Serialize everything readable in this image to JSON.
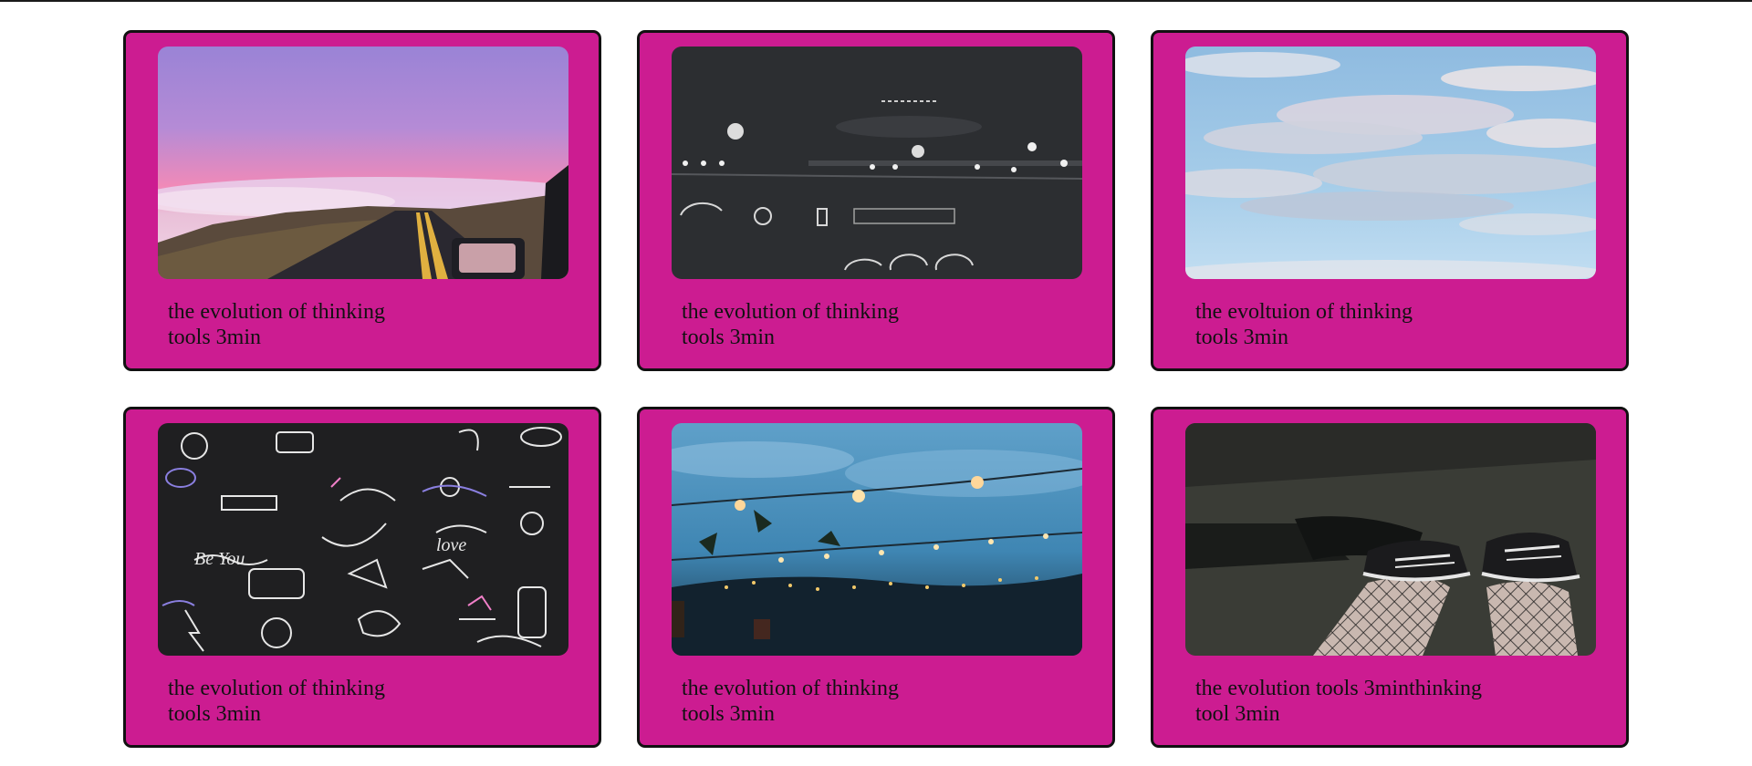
{
  "cards": [
    {
      "line1": "the evolution of thinking",
      "line2": "tools 3min",
      "image": "sunset-road-photo"
    },
    {
      "line1": "the evolution of thinking",
      "line2": "tools 3min",
      "image": "night-car-dashboard-photo"
    },
    {
      "line1": "the evoltuion of thinking",
      "line2": "tools 3min",
      "image": "cloudy-sky-photo"
    },
    {
      "line1": "the evolution of thinking",
      "line2": "tools 3min",
      "image": "neon-doodles-photo"
    },
    {
      "line1": "the evolution of thinking",
      "line2": "tools 3min",
      "image": "string-lights-sky-photo"
    },
    {
      "line1": "the evolution tools 3minthinking",
      "line2": "tool 3min",
      "image": "sneakers-fishnets-photo"
    }
  ],
  "colors": {
    "card_background": "#cc1c91",
    "card_border": "#111111",
    "page_background": "#ffffff",
    "text": "#111111"
  }
}
